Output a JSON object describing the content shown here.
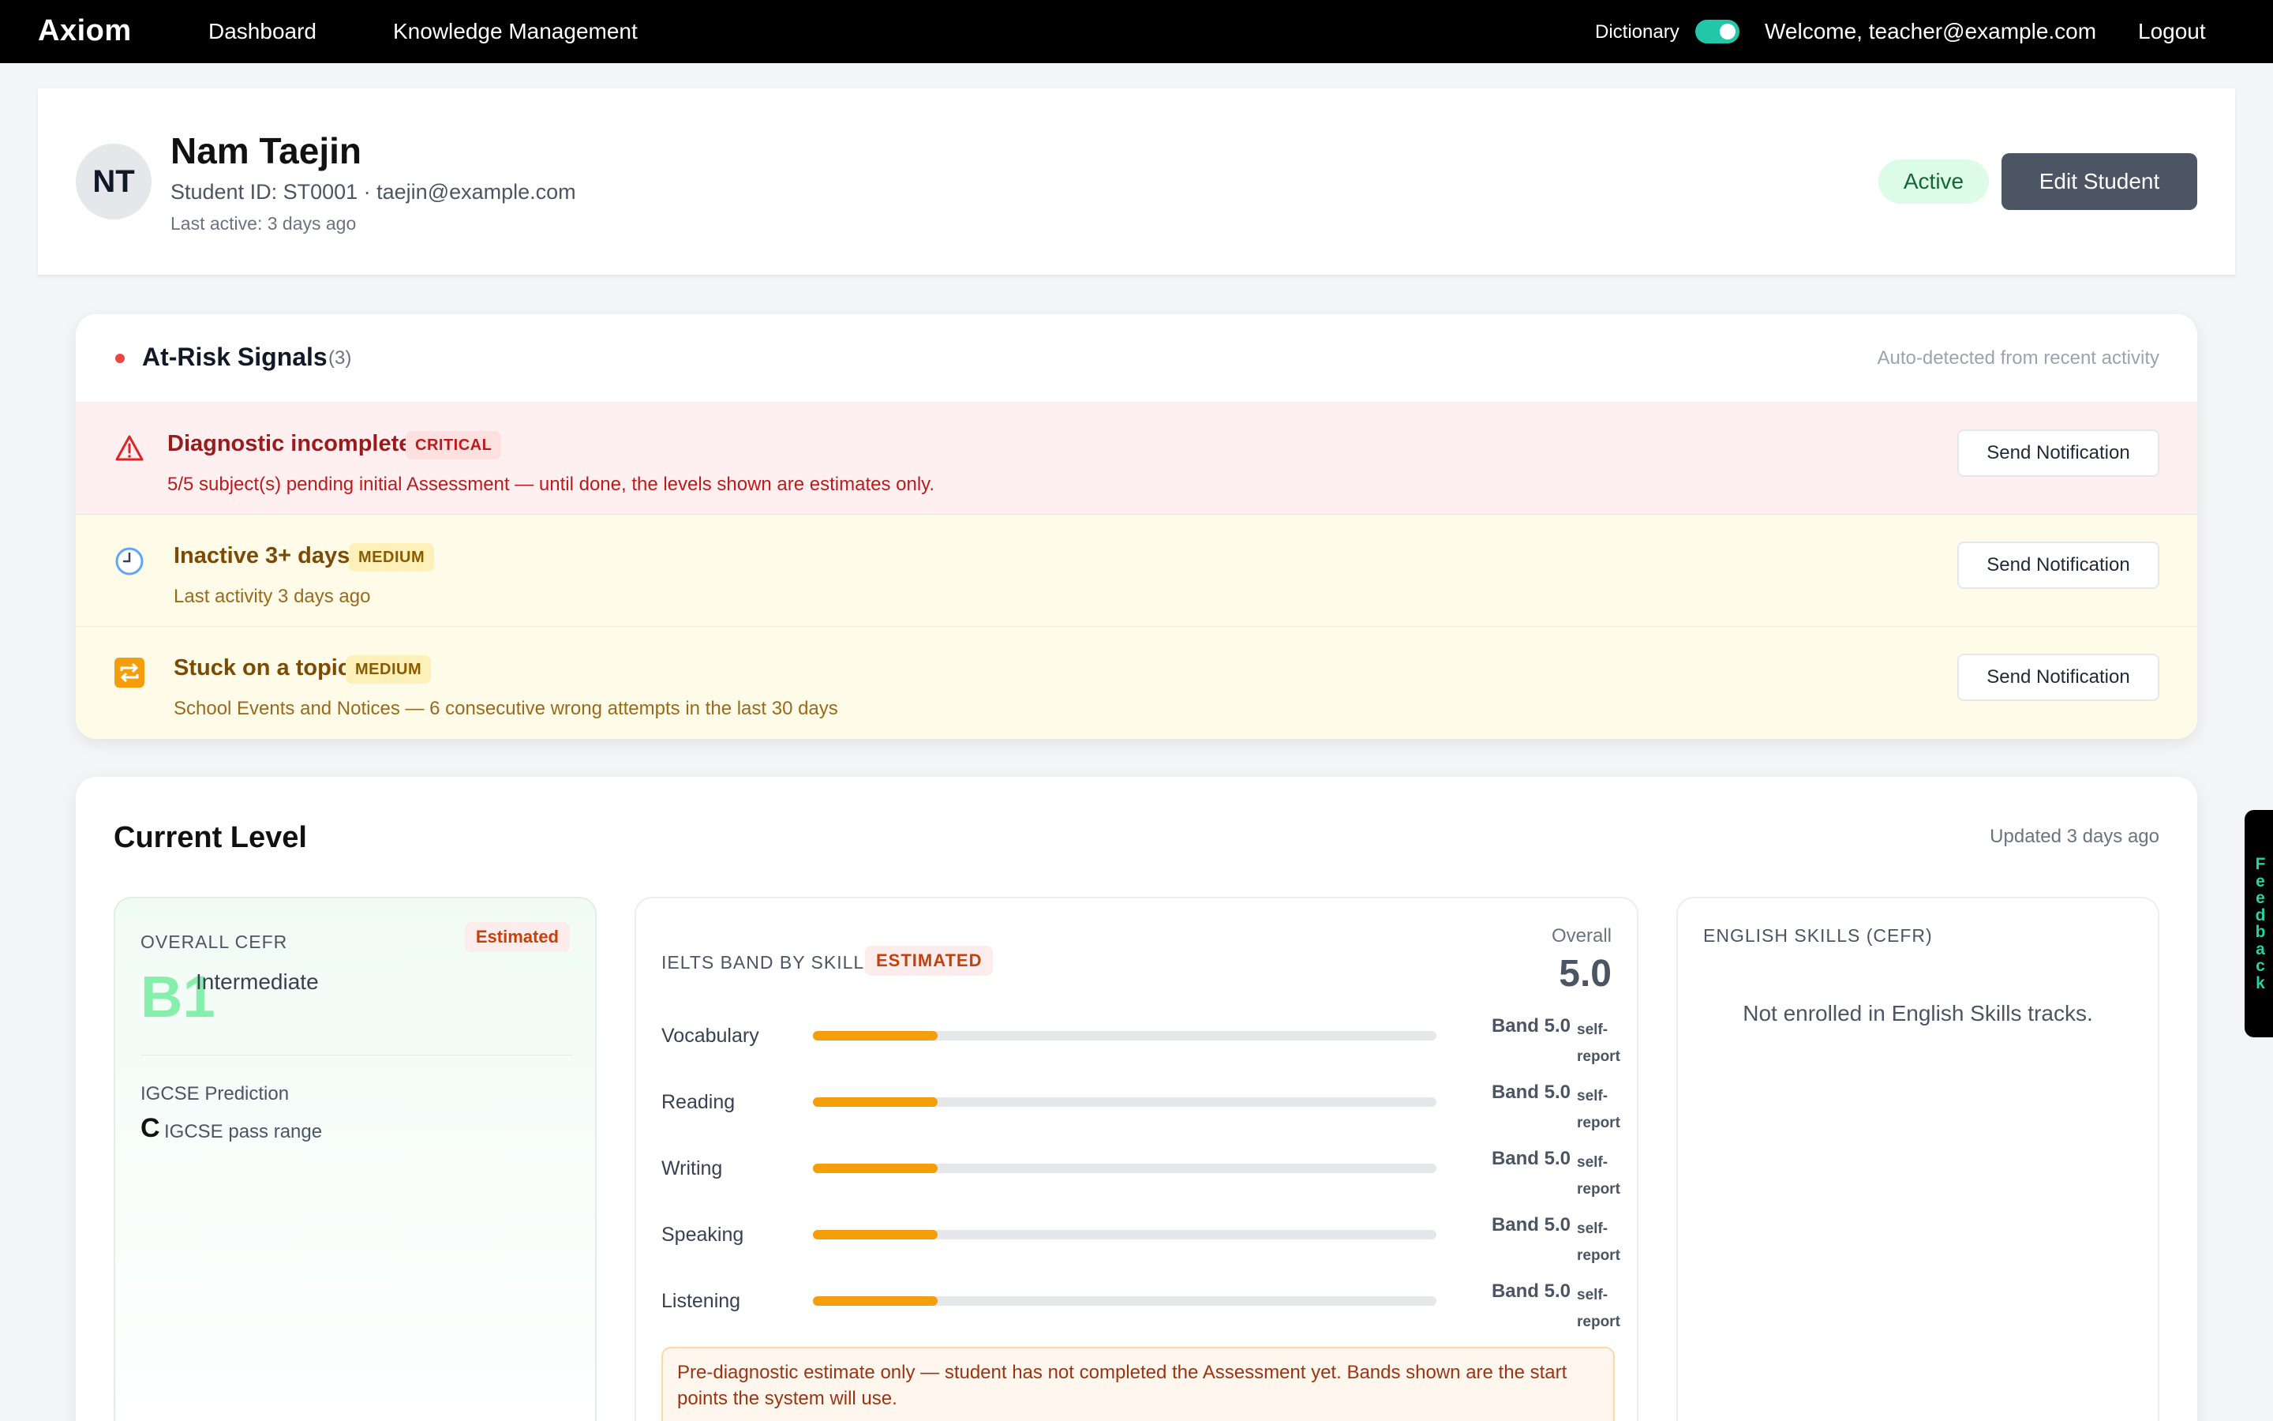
{
  "nav": {
    "logo": "Axiom",
    "links": [
      "Dashboard",
      "Knowledge Management"
    ],
    "dictionary_label": "Dictionary",
    "dictionary_on": true,
    "welcome": "Welcome, teacher@example.com",
    "logout": "Logout"
  },
  "student": {
    "initials": "NT",
    "name": "Nam Taejin",
    "id_line": "Student ID: ST0001 · taejin@example.com",
    "last_active": "Last active: 3 days ago",
    "status": "Active",
    "edit_label": "Edit Student"
  },
  "risk": {
    "title": "At-Risk Signals",
    "count": "(3)",
    "auto_note": "Auto-detected from recent activity",
    "notify_label": "Send Notification",
    "signals": [
      {
        "icon": "warning-triangle-icon",
        "title": "Diagnostic incomplete",
        "severity": "CRITICAL",
        "desc": "5/5 subject(s) pending initial Assessment — until done, the levels shown are estimates only."
      },
      {
        "icon": "clock-icon",
        "title": "Inactive 3+ days",
        "severity": "MEDIUM",
        "desc": "Last activity 3 days ago"
      },
      {
        "icon": "repeat-icon",
        "title": "Stuck on a topic",
        "severity": "MEDIUM",
        "desc": "School Events and Notices — 6 consecutive wrong attempts in the last 30 days"
      }
    ]
  },
  "level": {
    "title": "Current Level",
    "updated": "Updated 3 days ago",
    "cefr": {
      "label": "OVERALL CEFR",
      "tag": "Estimated",
      "level": "B1",
      "desc": "Intermediate",
      "igcse_label": "IGCSE Prediction",
      "igcse_grade": "C",
      "igcse_range": "IGCSE pass range"
    },
    "ielts": {
      "label": "IELTS BAND BY SKILL",
      "tag": "ESTIMATED",
      "overall_label": "Overall",
      "overall": "5.0",
      "band_max": 9,
      "skills": [
        {
          "name": "Vocabulary",
          "band_text": "Band 5.0",
          "band": 5.0,
          "source": "self-report"
        },
        {
          "name": "Reading",
          "band_text": "Band 5.0",
          "band": 5.0,
          "source": "self-report"
        },
        {
          "name": "Writing",
          "band_text": "Band 5.0",
          "band": 5.0,
          "source": "self-report"
        },
        {
          "name": "Speaking",
          "band_text": "Band 5.0",
          "band": 5.0,
          "source": "self-report"
        },
        {
          "name": "Listening",
          "band_text": "Band 5.0",
          "band": 5.0,
          "source": "self-report"
        }
      ],
      "note": "Pre-diagnostic estimate only — student has not completed the Assessment yet. Bands shown are the start points the system will use."
    },
    "english": {
      "label": "ENGLISH SKILLS (CEFR)",
      "empty": "Not enrolled in English Skills tracks."
    }
  },
  "feedback": {
    "label": "Feedback"
  },
  "colors": {
    "accent_toggle": "#22c7a9",
    "critical_bg": "#fef0f0",
    "medium_bg": "#fefbe8",
    "band_fill": "#f59e0b",
    "cefr_level": "#86efac"
  }
}
